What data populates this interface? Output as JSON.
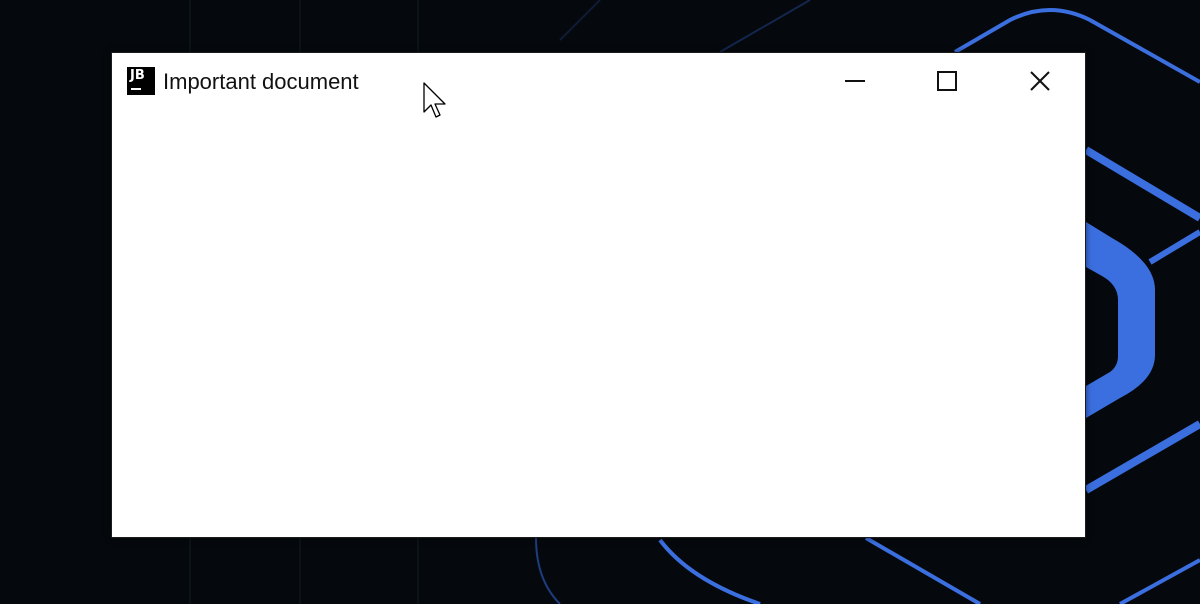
{
  "window": {
    "title": "Important document",
    "app_icon": {
      "name": "jetbrains-logo-icon",
      "text": "JB"
    },
    "controls": {
      "minimize_icon": "minimize-icon",
      "maximize_icon": "maximize-icon",
      "close_icon": "close-icon"
    }
  },
  "colors": {
    "desktop_background": "#05090d",
    "wallpaper_accent": "#3b6fe0",
    "window_background": "#ffffff",
    "title_text": "#111111"
  },
  "cursor": {
    "icon": "arrow-pointer-icon"
  }
}
